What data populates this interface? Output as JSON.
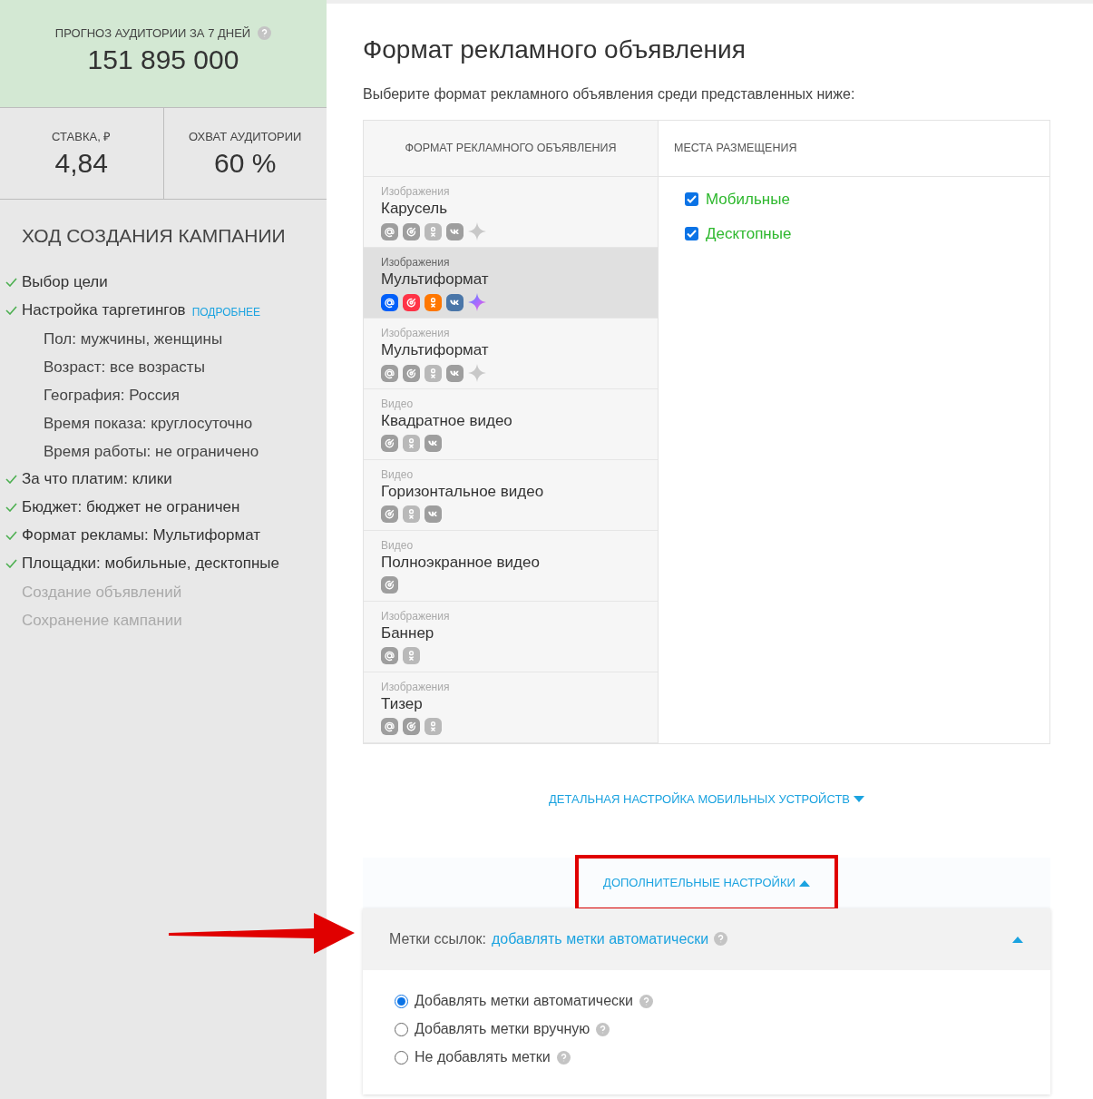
{
  "forecast": {
    "label": "ПРОГНОЗ АУДИТОРИИ ЗА 7 ДНЕЙ",
    "value": "151 895 000"
  },
  "stats": [
    {
      "label": "СТАВКА, ₽",
      "value": "4,84"
    },
    {
      "label": "ОХВАТ АУДИТОРИИ",
      "value": "60 %"
    }
  ],
  "progress": {
    "title": "ХОД СОЗДАНИЯ КАМПАНИИ",
    "steps": [
      {
        "kind": "done",
        "text": "Выбор цели"
      },
      {
        "kind": "done",
        "text": "Настройка таргетингов",
        "link": "ПОДРОБНЕЕ"
      },
      {
        "kind": "sub",
        "text": "Пол: мужчины, женщины"
      },
      {
        "kind": "sub",
        "text": "Возраст: все возрасты"
      },
      {
        "kind": "sub",
        "text": "География: Россия"
      },
      {
        "kind": "sub",
        "text": "Время показа: круглосуточно"
      },
      {
        "kind": "sub",
        "text": "Время работы: не ограничено"
      },
      {
        "kind": "done",
        "text": "За что платим: клики"
      },
      {
        "kind": "done",
        "text": "Бюджет: бюджет не ограничен"
      },
      {
        "kind": "done",
        "text": "Формат рекламы: Мультиформат"
      },
      {
        "kind": "done",
        "text": "Площадки: мобильные, десктопные"
      },
      {
        "kind": "pending",
        "text": "Создание объявлений"
      },
      {
        "kind": "pending",
        "text": "Сохранение кампании"
      }
    ]
  },
  "main": {
    "title": "Формат рекламного объявления",
    "subtitle": "Выберите формат рекламного объявления среди представленных ниже:"
  },
  "table": {
    "columns": [
      "ФОРМАТ РЕКЛАМНОГО ОБЪЯВЛЕНИЯ",
      "МЕСТА РАЗМЕЩЕНИЯ"
    ],
    "formats": [
      {
        "category": "Изображения",
        "name": "Карусель",
        "selected": false,
        "platforms": [
          {
            "kind": "mail"
          },
          {
            "kind": "target"
          },
          {
            "kind": "ok"
          },
          {
            "kind": "vk"
          },
          {
            "kind": "star"
          }
        ]
      },
      {
        "category": "Изображения",
        "name": "Мультиформат",
        "selected": true,
        "platforms": [
          {
            "kind": "mail"
          },
          {
            "kind": "target"
          },
          {
            "kind": "ok"
          },
          {
            "kind": "vk"
          },
          {
            "kind": "star"
          }
        ]
      },
      {
        "category": "Изображения",
        "name": "Мультиформат",
        "selected": false,
        "platforms": [
          {
            "kind": "mail"
          },
          {
            "kind": "target"
          },
          {
            "kind": "ok"
          },
          {
            "kind": "vk"
          },
          {
            "kind": "star"
          }
        ]
      },
      {
        "category": "Видео",
        "name": "Квадратное видео",
        "selected": false,
        "platforms": [
          {
            "kind": "target"
          },
          {
            "kind": "ok"
          },
          {
            "kind": "vk"
          }
        ]
      },
      {
        "category": "Видео",
        "name": "Горизонтальное видео",
        "selected": false,
        "platforms": [
          {
            "kind": "target"
          },
          {
            "kind": "ok"
          },
          {
            "kind": "vk"
          }
        ]
      },
      {
        "category": "Видео",
        "name": "Полноэкранное видео",
        "selected": false,
        "platforms": [
          {
            "kind": "target"
          }
        ]
      },
      {
        "category": "Изображения",
        "name": "Баннер",
        "selected": false,
        "platforms": [
          {
            "kind": "mail"
          },
          {
            "kind": "ok"
          }
        ]
      },
      {
        "category": "Изображения",
        "name": "Тизер",
        "selected": false,
        "platforms": [
          {
            "kind": "mail"
          },
          {
            "kind": "target"
          },
          {
            "kind": "ok"
          }
        ]
      }
    ],
    "placements": [
      {
        "label": "Мобильные",
        "checked": true
      },
      {
        "label": "Десктопные",
        "checked": true
      }
    ]
  },
  "mobile_settings": {
    "label": "ДЕТАЛЬНАЯ НАСТРОЙКА МОБИЛЬНЫХ УСТРОЙСТВ",
    "expanded": false
  },
  "additional_settings": {
    "label": "ДОПОЛНИТЕЛЬНЫЕ НАСТРОЙКИ",
    "expanded": true,
    "highlighted": true
  },
  "link_tags": {
    "label": "Метки ссылок:",
    "value": "добавлять метки автоматически",
    "expanded": true,
    "pointer_arrow": true,
    "options": [
      {
        "label": "Добавлять метки автоматически",
        "selected": true
      },
      {
        "label": "Добавлять метки вручную",
        "selected": false
      },
      {
        "label": "Не добавлять метки",
        "selected": false
      }
    ]
  }
}
